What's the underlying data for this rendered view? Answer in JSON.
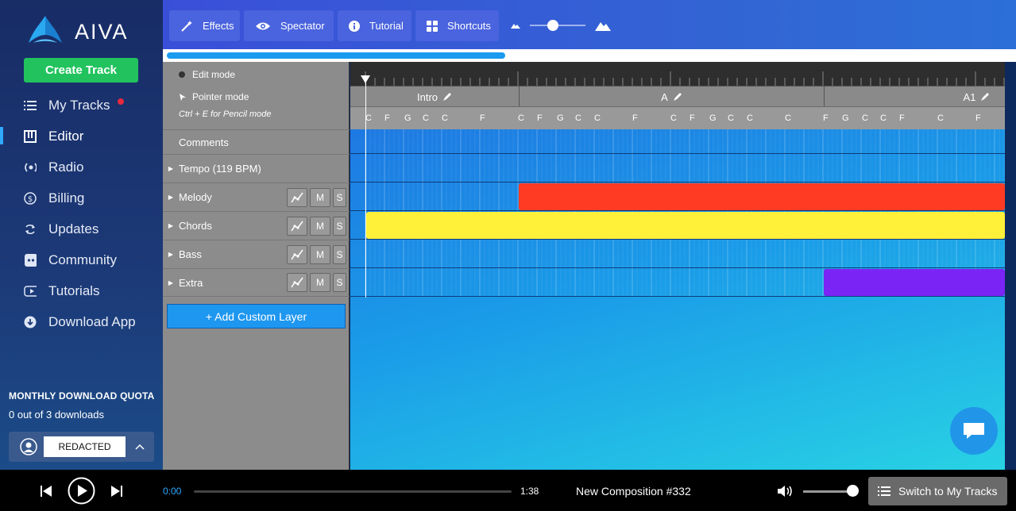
{
  "app": {
    "name": "AIVA"
  },
  "sidebar": {
    "create_label": "Create Track",
    "items": [
      {
        "label": "My Tracks",
        "icon": "list-icon",
        "notification": true
      },
      {
        "label": "Editor",
        "icon": "piano-icon",
        "active": true
      },
      {
        "label": "Radio",
        "icon": "radio-icon"
      },
      {
        "label": "Billing",
        "icon": "dollar-icon"
      },
      {
        "label": "Updates",
        "icon": "refresh-icon"
      },
      {
        "label": "Community",
        "icon": "discord-icon"
      },
      {
        "label": "Tutorials",
        "icon": "youtube-icon"
      },
      {
        "label": "Download App",
        "icon": "download-icon"
      }
    ],
    "quota_title": "MONTHLY DOWNLOAD QUOTA",
    "quota_text": "0 out of 3 downloads",
    "user_name": "REDACTED"
  },
  "toolbar": {
    "effects_label": "Effects",
    "spectator_label": "Spectator",
    "tutorial_label": "Tutorial",
    "shortcuts_label": "Shortcuts",
    "zoom_level": 0.4
  },
  "progress": {
    "value": 0.4
  },
  "modes": {
    "edit_label": "Edit mode",
    "pointer_label": "Pointer mode",
    "hint": "Ctrl + E for Pencil mode"
  },
  "layers": {
    "comments_label": "Comments",
    "tempo_label": "Tempo (119 BPM)",
    "tracks": [
      {
        "label": "Melody",
        "m": "M",
        "s": "S"
      },
      {
        "label": "Chords",
        "m": "M",
        "s": "S"
      },
      {
        "label": "Bass",
        "m": "M",
        "s": "S"
      },
      {
        "label": "Extra",
        "m": "M",
        "s": "S"
      }
    ],
    "add_label": "+ Add Custom Layer"
  },
  "timeline": {
    "sections": [
      {
        "label": "Intro"
      },
      {
        "label": "A"
      },
      {
        "label": "A1"
      }
    ],
    "chords": [
      "C",
      "F",
      "G",
      "C",
      "C",
      "F",
      "C",
      "F",
      "G",
      "C",
      "C",
      "F",
      "C",
      "F",
      "G",
      "C",
      "C",
      "C",
      "F",
      "G",
      "C",
      "C",
      "F",
      "C",
      "F"
    ],
    "colors": {
      "melody": "#ff3b24",
      "chords": "#fff03a",
      "extra": "#7a24f5"
    }
  },
  "player": {
    "current_time": "0:00",
    "total_time": "1:38",
    "title": "New Composition #332",
    "switch_label": "Switch to My Tracks"
  }
}
